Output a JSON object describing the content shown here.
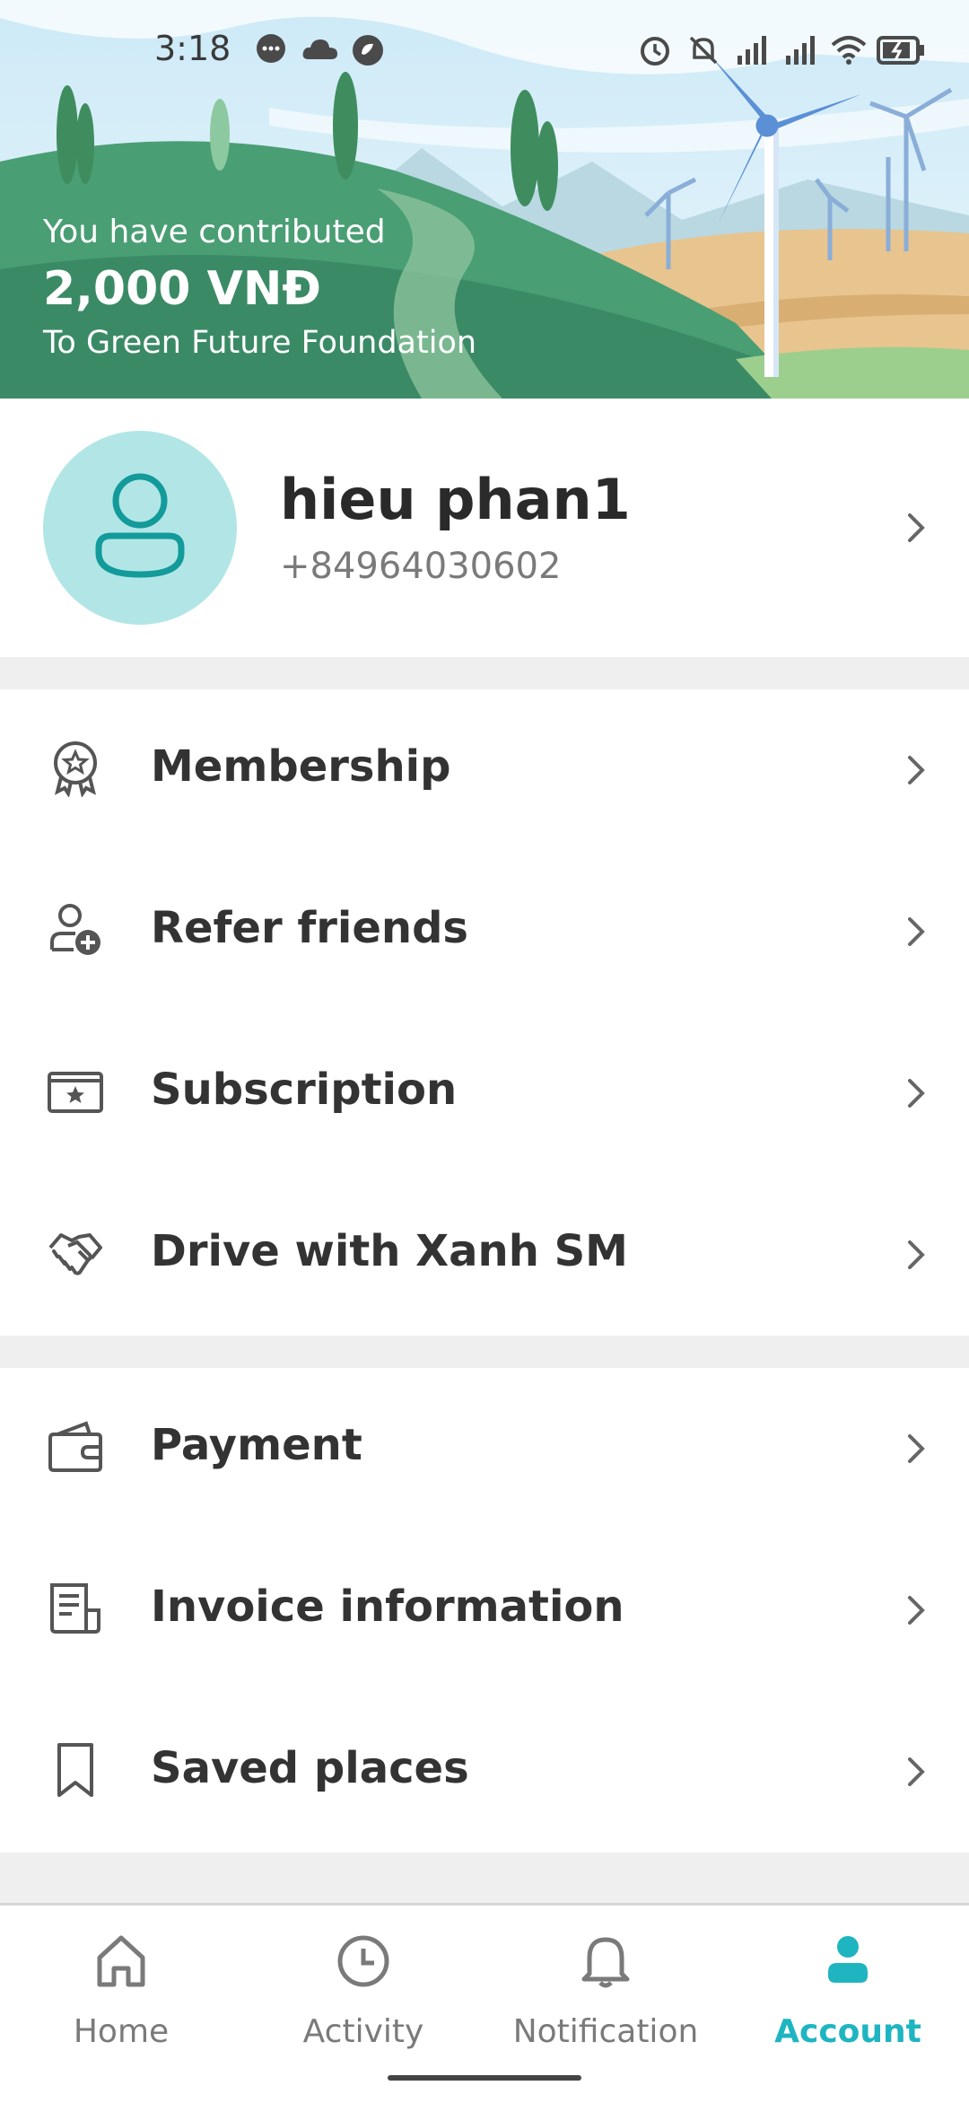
{
  "status_bar": {
    "time": "3:18",
    "left_icons": [
      "message-icon",
      "cloud-icon",
      "app-icon"
    ],
    "right_icons": [
      "alarm-icon",
      "mute-icon",
      "signal-icon",
      "signal-icon",
      "wifi-icon",
      "battery-icon"
    ]
  },
  "banner": {
    "line1": "You have contributed",
    "amount": "2,000 VNĐ",
    "line3": "To Green Future Foundation"
  },
  "profile": {
    "name": "hieu phan1",
    "phone": "+84964030602"
  },
  "menu_group_1": [
    {
      "label": "Membership",
      "icon": "badge-icon"
    },
    {
      "label": "Refer friends",
      "icon": "add-user-icon"
    },
    {
      "label": "Subscription",
      "icon": "star-card-icon"
    },
    {
      "label": "Drive with Xanh SM",
      "icon": "handshake-icon"
    }
  ],
  "menu_group_2": [
    {
      "label": "Payment",
      "icon": "wallet-icon"
    },
    {
      "label": "Invoice information",
      "icon": "invoice-icon"
    },
    {
      "label": "Saved places",
      "icon": "bookmark-icon"
    }
  ],
  "bottom_nav": [
    {
      "label": "Home",
      "icon": "home-icon",
      "active": false
    },
    {
      "label": "Activity",
      "icon": "clock-icon",
      "active": false
    },
    {
      "label": "Notification",
      "icon": "bell-icon",
      "active": false
    },
    {
      "label": "Account",
      "icon": "person-icon",
      "active": true
    }
  ],
  "colors": {
    "accent": "#1eb5c1",
    "avatar_bg": "#b2e6e6",
    "avatar_stroke": "#139a9a",
    "divider": "#efefef"
  }
}
